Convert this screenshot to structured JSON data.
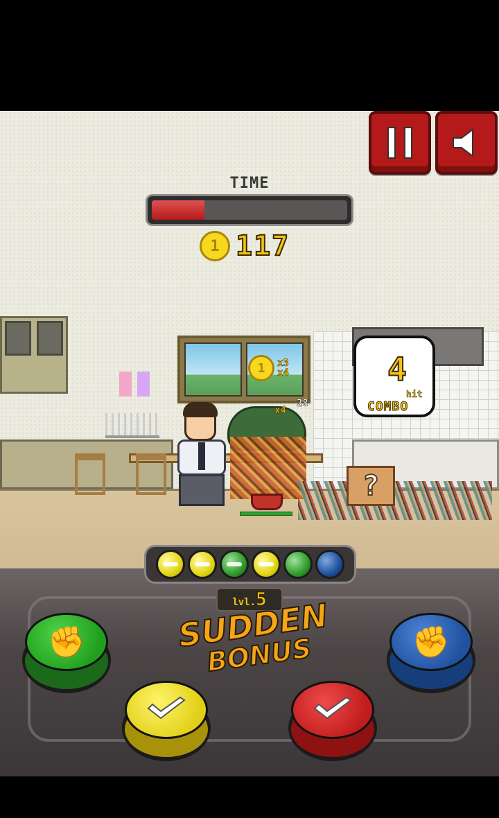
{
  "hud": {
    "pause_icon": "pause-icon",
    "sound_icon": "speaker-icon",
    "time_label": "TIME",
    "time_remaining": 0.27,
    "coin_glyph": "1",
    "coin_count": "117"
  },
  "popups": {
    "coin_glyph": "1",
    "multiplier_a": "x3",
    "multiplier_b": "x4",
    "multiplier_c": "x4",
    "multiplier_d": "28"
  },
  "combo": {
    "count": "4",
    "hit_label": "hit",
    "label": "COMBO"
  },
  "sequence": {
    "orbs": [
      "yellow",
      "yellow",
      "green",
      "yellow",
      "green",
      "blue"
    ],
    "cleared": [
      true,
      true,
      true,
      true,
      false,
      false
    ]
  },
  "bonus": {
    "level_prefix": "lvl.",
    "level_number": "5",
    "line1": "SUDDEN",
    "line2": "BONUS"
  },
  "mystery_box": "?",
  "controls": {
    "green_icon": "fist-icon",
    "blue_icon": "fist-icon",
    "yellow_icon": "chop-hand-icon",
    "red_icon": "chop-hand-icon"
  },
  "colors": {
    "green": "#21a01d",
    "blue": "#21529e",
    "yellow": "#e2d018",
    "red": "#c21d1d",
    "coin": "#f5c316"
  }
}
